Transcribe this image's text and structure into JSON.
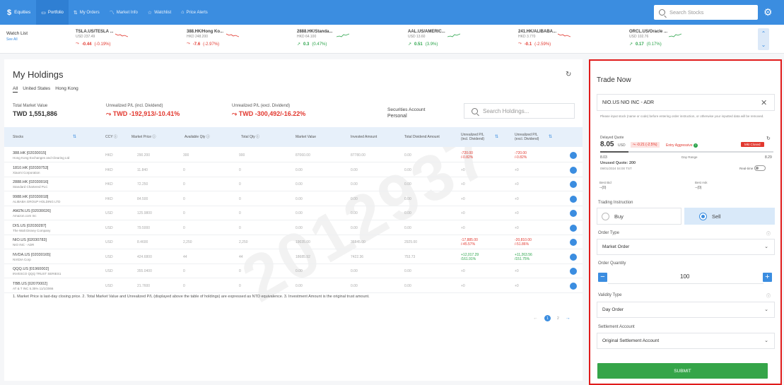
{
  "nav": {
    "brand": "Equities",
    "items": [
      {
        "label": "Portfolio",
        "icon": "briefcase-icon",
        "glyph": "▭",
        "active": true
      },
      {
        "label": "My Orders",
        "icon": "orders-icon",
        "glyph": "⇅",
        "active": false
      },
      {
        "label": "Market Info",
        "icon": "chart-icon",
        "glyph": "〽",
        "active": false
      },
      {
        "label": "Watchlist",
        "icon": "star-icon",
        "glyph": "☆",
        "active": false
      },
      {
        "label": "Price Alerts",
        "icon": "bell-icon",
        "glyph": "⌂",
        "active": false
      }
    ],
    "search_placeholder": "Search Stocks"
  },
  "watchlist": {
    "label": "Watch List",
    "see_all": "See All",
    "items": [
      {
        "name": "TSLA.US/TESLA ...",
        "price": "USD 237.49",
        "change": "-0.44",
        "pct": "(-0.19%)",
        "dir": "down"
      },
      {
        "name": "388.HK/Hong Ko...",
        "price": "HKD 248.200",
        "change": "-7.6",
        "pct": "(-2.97%)",
        "dir": "down"
      },
      {
        "name": "2888.HK/Standa...",
        "price": "HKD 64.100",
        "change": "0.3",
        "pct": "(0.47%)",
        "dir": "up"
      },
      {
        "name": "AAL.US/AMERIC...",
        "price": "USD 13.60",
        "change": "0.51",
        "pct": "(3.9%)",
        "dir": "up"
      },
      {
        "name": "241.HK/ALIBABA...",
        "price": "HKD 3.770",
        "change": "-0.1",
        "pct": "(-2.59%)",
        "dir": "down"
      },
      {
        "name": "ORCL.US/Oracle ...",
        "price": "USD 102.76",
        "change": "0.17",
        "pct": "(0.17%)",
        "dir": "up"
      }
    ]
  },
  "holdings": {
    "title": "My Holdings",
    "tabs": [
      "All",
      "United States",
      "Hong Kong"
    ],
    "total_label": "Total Market Value",
    "total_value": "TWD 1,551,886",
    "unreal_incl_label": "Unrealized P/L (incl. Dividend)",
    "unreal_incl_value": "TWD -192,913/-10.41%",
    "unreal_excl_label": "Unrealized P/L (excl. Dividend)",
    "unreal_excl_value": "TWD -300,492/-16.22%",
    "sec_account_label": "Securities Account",
    "sec_account_value": "Personal",
    "search_placeholder": "Search Holdings...",
    "columns": [
      "Stocks",
      "CCY",
      "Market Price",
      "Available Qty",
      "Total Qty",
      "Market Value",
      "Invested Amount",
      "Total Dividend Amount",
      "Unrealized P/L (incl. Dividend)",
      "Unrealized P/L (excl. Dividend)"
    ],
    "rows": [
      {
        "code": "388.HK [02030015]",
        "name": "Hong Kong Exchanges and Clearing Ltd",
        "ccy": "HKD",
        "price": "290.200",
        "avail": "300",
        "total": "900",
        "mv": "87060.00",
        "inv": "87780.00",
        "div": "0.00",
        "pl1": "-720.00",
        "pl1b": "/-0.82%",
        "pl2": "-720.00",
        "pl2b": "/-0.82%",
        "pl_class": "redv"
      },
      {
        "code": "1810.HK [02030753]",
        "name": "Xiaomi Corporation",
        "ccy": "HKD",
        "price": "11.840",
        "avail": "0",
        "total": "0",
        "mv": "0.00",
        "inv": "0.00",
        "div": "0.00",
        "pl1": "+0",
        "pl1b": "",
        "pl2": "+0",
        "pl2b": "",
        "pl_class": ""
      },
      {
        "code": "2888.HK [02030016]",
        "name": "Standard Chartered PLC",
        "ccy": "HKD",
        "price": "72.250",
        "avail": "0",
        "total": "0",
        "mv": "0.00",
        "inv": "0.00",
        "div": "0.00",
        "pl1": "+0",
        "pl1b": "",
        "pl2": "+0",
        "pl2b": "",
        "pl_class": ""
      },
      {
        "code": "9988.HK [02030018]",
        "name": "ALIBABA GROUP HOLDING LTD",
        "ccy": "HKD",
        "price": "84.500",
        "avail": "0",
        "total": "0",
        "mv": "0.00",
        "inv": "0.00",
        "div": "0.00",
        "pl1": "+0",
        "pl1b": "",
        "pl2": "+0",
        "pl2b": "",
        "pl_class": ""
      },
      {
        "code": "AMZN.US [02030026]",
        "name": "Amazon.com Inc",
        "ccy": "USD",
        "price": "125.9800",
        "avail": "0",
        "total": "0",
        "mv": "0.00",
        "inv": "0.00",
        "div": "0.00",
        "pl1": "+0",
        "pl1b": "",
        "pl2": "+0",
        "pl2b": "",
        "pl_class": ""
      },
      {
        "code": "DIS.US [02030287]",
        "name": "The Walt Disney Company",
        "ccy": "USD",
        "price": "79.5000",
        "avail": "0",
        "total": "0",
        "mv": "0.00",
        "inv": "0.00",
        "div": "0.00",
        "pl1": "+0",
        "pl1b": "",
        "pl2": "+0",
        "pl2b": "",
        "pl_class": ""
      },
      {
        "code": "NIO.US [02030783]",
        "name": "NIO INC - ADR",
        "ccy": "USD",
        "price": "8.4600",
        "avail": "2,250",
        "total": "2,250",
        "mv": "19035.00",
        "inv": "36845.00",
        "div": "2925.00",
        "pl1": "-17,885.00",
        "pl1b": "/-45.57%",
        "pl2": "-20,810.00",
        "pl2b": "/-51.86%",
        "pl_class": "redv"
      },
      {
        "code": "NVDA.US [02030165]",
        "name": "NVIDIA Corp",
        "ccy": "USD",
        "price": "424.6800",
        "avail": "44",
        "total": "44",
        "mv": "18685.92",
        "inv": "7422.36",
        "div": "753.73",
        "pl1": "+12,017.29",
        "pl1b": "/161.91%",
        "pl2": "+11,263.56",
        "pl2b": "/151.75%",
        "pl_class": "greenv"
      },
      {
        "code": "QQQ.US [01960002]",
        "name": "INVESCO QQQ TRUST SERIES1",
        "ccy": "USD",
        "price": "355.0400",
        "avail": "0",
        "total": "0",
        "mv": "0.00",
        "inv": "0.00",
        "div": "0.00",
        "pl1": "+0",
        "pl1b": "",
        "pl2": "+0",
        "pl2b": "",
        "pl_class": ""
      },
      {
        "code": "TBB.US [02070002]",
        "name": "AT & T INC 5.35% 11/1/2066",
        "ccy": "USD",
        "price": "21.7600",
        "avail": "0",
        "total": "0",
        "mv": "0.00",
        "inv": "0.00",
        "div": "0.00",
        "pl1": "+0",
        "pl1b": "",
        "pl2": "+0",
        "pl2b": "",
        "pl_class": ""
      }
    ],
    "footnote": "1. Market Price is last-day closing price.   2. Total Market Value and Unrealized P/L (displayed above the table of holdings) are expressed as NTD equivalence.   3. Investment Amount is the original trust amount.",
    "pager": {
      "current": "1",
      "next_page": "2"
    },
    "watermark": "2012937"
  },
  "trade": {
    "title": "Trade Now",
    "stock": "NIO.US NIO INC - ADR",
    "note": "Please input stock (name or code) before entering order instruction, or otherwise your inputted data will be removed.",
    "quote_label": "Delayed Quote",
    "price": "8.05",
    "currency": "USD",
    "change": "-0.21 (-2.5%)",
    "entry": "Entry Aggressive",
    "status": "Mkt Closed",
    "low": "8.03",
    "range_label": "Day Range",
    "high": "8.29",
    "unused_label": "Unused Quote: 200",
    "quote_time": "09/01/2024 04:00 TST",
    "realtime_label": "Real-time",
    "best_bid_label": "Best Bid",
    "best_bid": "--(0)",
    "best_ask_label": "Best Ask",
    "best_ask": "--(0)",
    "instruction_label": "Trading Instruction",
    "buy_label": "Buy",
    "sell_label": "Sell",
    "order_type_label": "Order Type",
    "order_type": "Market Order",
    "qty_label": "Order Quantity",
    "qty": "100",
    "validity_label": "Validity Type",
    "validity": "Day Order",
    "settlement_label": "Settlement Account",
    "settlement": "Original Settlement Account",
    "submit_label": "SUBMIT"
  },
  "colors": {
    "accent": "#3b8de0",
    "positive": "#2aa34a",
    "negative": "#e2382f",
    "submit": "#35a549",
    "highlight_border": "#e01b1b"
  }
}
